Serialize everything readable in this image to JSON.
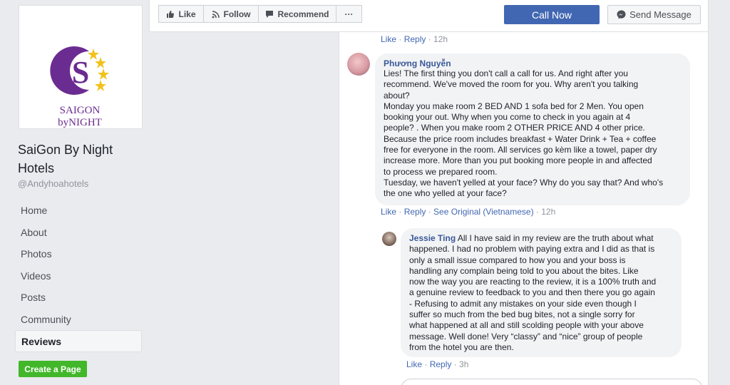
{
  "page": {
    "logo_text_line1": "SAIGON",
    "logo_text_line2": "byNIGHT",
    "name": "SaiGon By Night Hotels",
    "handle": "@Andyhoahotels"
  },
  "nav": {
    "items": [
      "Home",
      "About",
      "Photos",
      "Videos",
      "Posts",
      "Community",
      "Reviews"
    ],
    "active": "Reviews"
  },
  "create_page_label": "Create a Page",
  "actions": {
    "like": "Like",
    "follow": "Follow",
    "recommend": "Recommend",
    "more": "···",
    "call": "Call Now",
    "message": "Send Message"
  },
  "top_meta": {
    "like": "Like",
    "reply": "Reply",
    "time": "12h"
  },
  "comments": [
    {
      "author": "Phương Nguyễn",
      "text": "Lies! The first thing you don't call a call for us. And right after you\nrecommend. We've moved the room for you. Why aren't you talking\nabout?\nMonday you make room 2 BED AND 1 sofa bed for 2 Men. You open\nbooking your out. Why when you come to check in you again at 4\npeople? . When you make room 2 OTHER PRICE AND 4 other price.\nBecause the price room includes breakfast + Water Drink + Tea + coffee\nfree for everyone in the room. All services go kèm like a towel, paper dry\nincrease more. More than you put booking more people in and affected\nto process we prepared room.\nTuesday, we haven't yelled at your face? Why do you say that? And who's\nthe one who yelled at your face?",
      "like": "Like",
      "reply": "Reply",
      "see_original": "See Original (Vietnamese)",
      "time": "12h"
    },
    {
      "author": "Jessie Ting",
      "text_first": "All I have said in my review are the truth about what",
      "text": "happened. I had no problem with paying extra and I did as that is\nonly a small issue compared to how you and your boss is\nhandling any complain being told to you about the bites. Like\nnow the way you are reacting to the review, it is a 100% truth and\na genuine review to feedback to you and then there you go again\n- Refusing to admit any mistakes on your side even though I\nsuffer so much from the bed bug bites, not a single sorry for\nwhat happened at all and still scolding people with your above\nmessage. Well done! Very “classy” and “nice” group of people\nfrom the hotel you are then.",
      "like": "Like",
      "reply": "Reply",
      "time": "3h"
    }
  ],
  "colors": {
    "brand_purple": "#6b2c91",
    "star_gold": "#f2c21b",
    "link_blue": "#4267b2",
    "green": "#42b72a"
  }
}
